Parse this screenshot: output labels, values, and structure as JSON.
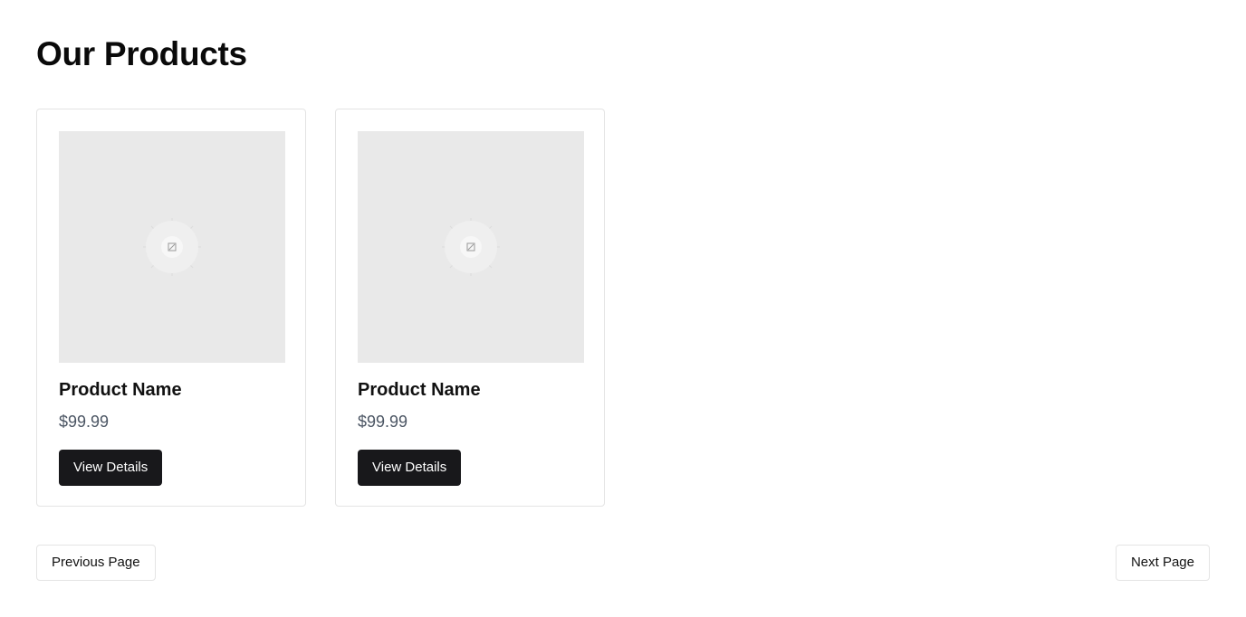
{
  "page": {
    "title": "Our Products"
  },
  "products": [
    {
      "name": "Product Name",
      "price": "$99.99",
      "button_label": "View Details",
      "image_icon": "image-placeholder-icon"
    },
    {
      "name": "Product Name",
      "price": "$99.99",
      "button_label": "View Details",
      "image_icon": "image-placeholder-icon"
    }
  ],
  "pagination": {
    "previous_label": "Previous Page",
    "next_label": "Next Page"
  },
  "colors": {
    "button_background": "#18181b",
    "image_placeholder": "#e9e9e9",
    "price_text": "#4b5563",
    "card_border": "#e4e4e4"
  }
}
